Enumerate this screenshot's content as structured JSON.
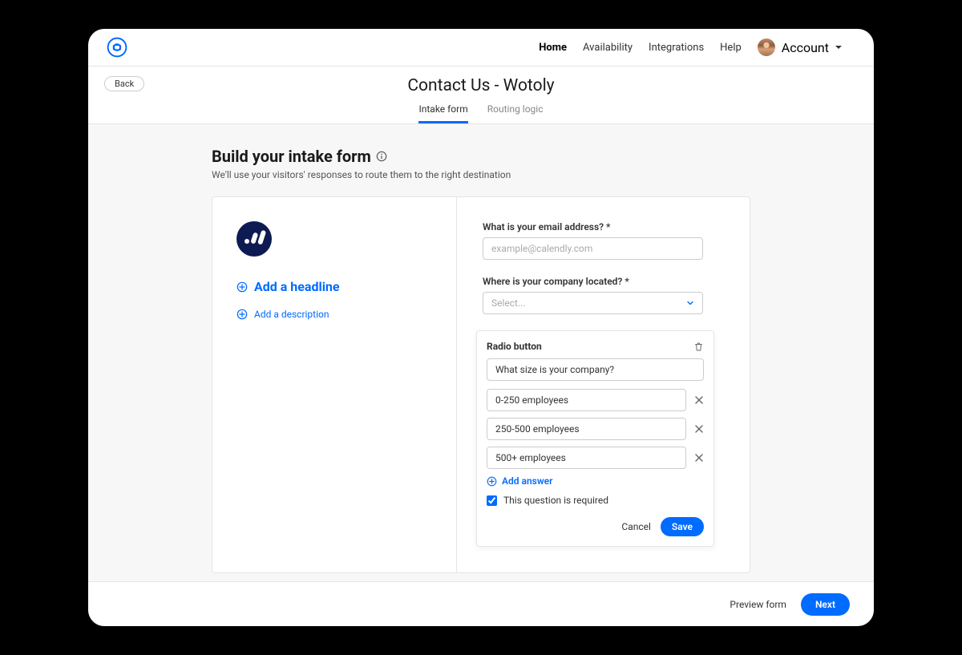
{
  "nav": {
    "home": "Home",
    "availability": "Availability",
    "integrations": "Integrations",
    "help": "Help",
    "account": "Account"
  },
  "header": {
    "back": "Back",
    "title": "Contact Us - Wotoly",
    "tab_intake": "Intake form",
    "tab_routing": "Routing logic"
  },
  "section": {
    "title": "Build your intake form",
    "sub": "We'll use your visitors' responses to route them to the right destination"
  },
  "left": {
    "headline_cta": "Add a headline",
    "description_cta": "Add a description"
  },
  "form": {
    "email_label": "What is your email address? *",
    "email_placeholder": "example@calendly.com",
    "location_label": "Where is your company located? *",
    "location_placeholder": "Select..."
  },
  "editor": {
    "type_label": "Radio button",
    "question": "What size is your company?",
    "options": [
      "0-250 employees",
      "250-500 employees",
      "500+ employees"
    ],
    "add_answer": "Add answer",
    "required_label": "This question is required",
    "required": true,
    "cancel": "Cancel",
    "save": "Save"
  },
  "footer": {
    "preview": "Preview form",
    "next": "Next"
  }
}
